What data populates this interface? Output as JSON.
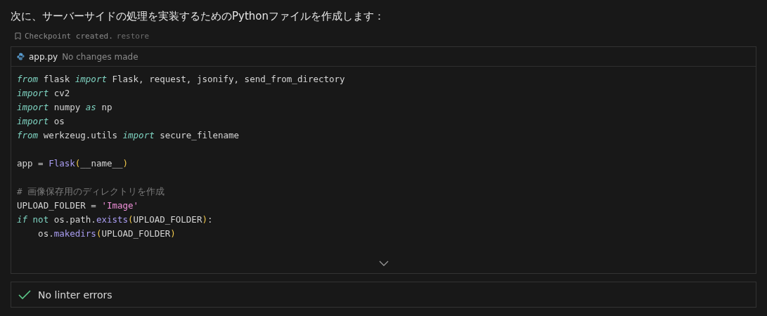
{
  "message": "次に、サーバーサイドの処理を実装するためのPythonファイルを作成します：",
  "checkpoint": {
    "text": "Checkpoint created.",
    "link": "restore"
  },
  "file": {
    "name": "app.py",
    "status": "No changes made"
  },
  "code_lines": [
    {
      "kind": "code",
      "tokens": [
        {
          "kind": "keyword",
          "text": "from"
        },
        {
          "kind": "plain",
          "text": " flask "
        },
        {
          "kind": "keyword",
          "text": "import"
        },
        {
          "kind": "plain",
          "text": " Flask, request, jsonify, send_from_directory"
        }
      ]
    },
    {
      "kind": "code",
      "tokens": [
        {
          "kind": "keyword",
          "text": "import"
        },
        {
          "kind": "plain",
          "text": " cv2"
        }
      ]
    },
    {
      "kind": "code",
      "tokens": [
        {
          "kind": "keyword",
          "text": "import"
        },
        {
          "kind": "plain",
          "text": " numpy "
        },
        {
          "kind": "keyword",
          "text": "as"
        },
        {
          "kind": "plain",
          "text": " np"
        }
      ]
    },
    {
      "kind": "code",
      "tokens": [
        {
          "kind": "keyword",
          "text": "import"
        },
        {
          "kind": "plain",
          "text": " os"
        }
      ]
    },
    {
      "kind": "code",
      "tokens": [
        {
          "kind": "keyword",
          "text": "from"
        },
        {
          "kind": "plain",
          "text": " werkzeug.utils "
        },
        {
          "kind": "keyword",
          "text": "import"
        },
        {
          "kind": "plain",
          "text": " secure_filename"
        }
      ]
    },
    {
      "kind": "blank"
    },
    {
      "kind": "code",
      "tokens": [
        {
          "kind": "plain",
          "text": "app = "
        },
        {
          "kind": "function",
          "text": "Flask"
        },
        {
          "kind": "paren",
          "text": "("
        },
        {
          "kind": "plain",
          "text": "__name__"
        },
        {
          "kind": "paren",
          "text": ")"
        }
      ]
    },
    {
      "kind": "blank"
    },
    {
      "kind": "code",
      "tokens": [
        {
          "kind": "comment",
          "text": "# 画像保存用のディレクトリを作成"
        }
      ]
    },
    {
      "kind": "code",
      "tokens": [
        {
          "kind": "plain",
          "text": "UPLOAD_FOLDER = "
        },
        {
          "kind": "string",
          "text": "'Image'"
        }
      ]
    },
    {
      "kind": "code",
      "tokens": [
        {
          "kind": "keyword",
          "text": "if "
        },
        {
          "kind": "operator",
          "text": "not"
        },
        {
          "kind": "plain",
          "text": " os.path."
        },
        {
          "kind": "function",
          "text": "exists"
        },
        {
          "kind": "paren",
          "text": "("
        },
        {
          "kind": "plain",
          "text": "UPLOAD_FOLDER"
        },
        {
          "kind": "paren",
          "text": ")"
        },
        {
          "kind": "plain",
          "text": ":"
        }
      ]
    },
    {
      "kind": "code",
      "tokens": [
        {
          "kind": "plain",
          "text": "    os."
        },
        {
          "kind": "function",
          "text": "makedirs"
        },
        {
          "kind": "paren",
          "text": "("
        },
        {
          "kind": "plain",
          "text": "UPLOAD_FOLDER"
        },
        {
          "kind": "paren",
          "text": ")"
        }
      ]
    }
  ],
  "linter": {
    "text": "No linter errors"
  }
}
